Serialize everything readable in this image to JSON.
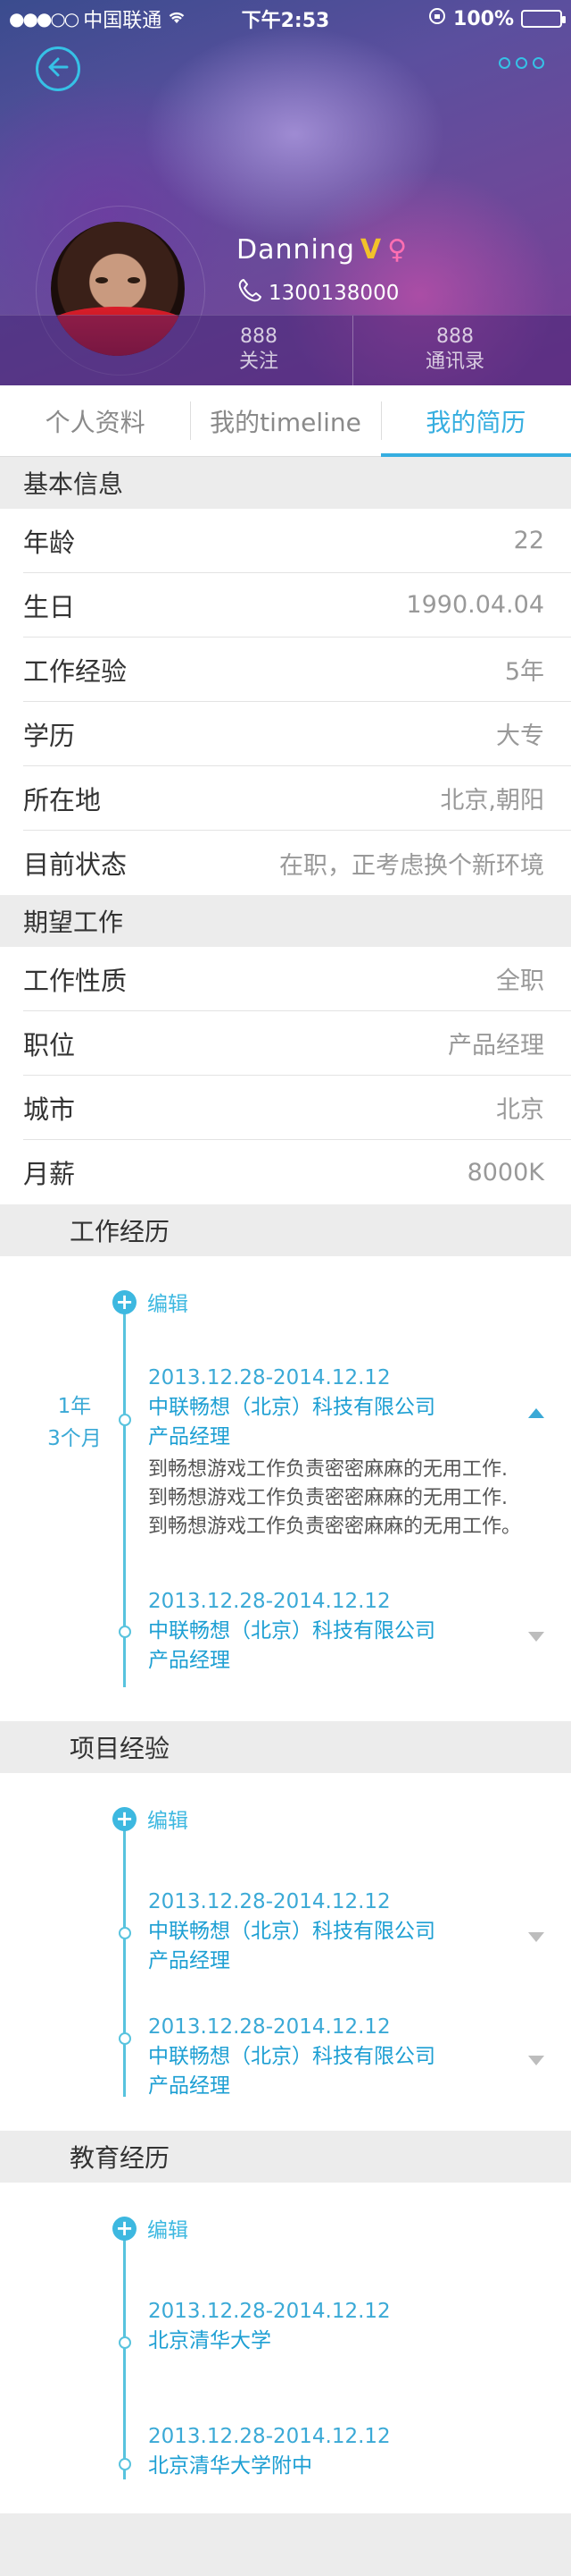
{
  "status_bar": {
    "carrier": "中国联通",
    "time": "下午2:53",
    "battery": "100%"
  },
  "profile": {
    "name": "Danning",
    "vip": "V",
    "gender": "♀",
    "phone": "1300138000",
    "follow_count": "888",
    "follow_label": "关注",
    "contacts_count": "888",
    "contacts_label": "通讯录"
  },
  "tabs": [
    {
      "label": "个人资料"
    },
    {
      "label": "我的timeline"
    },
    {
      "label": "我的简历",
      "active": true
    }
  ],
  "basic_info": {
    "title": "基本信息",
    "rows": [
      {
        "label": "年龄",
        "value": "22"
      },
      {
        "label": "生日",
        "value": "1990.04.04"
      },
      {
        "label": "工作经验",
        "value": "5年"
      },
      {
        "label": "学历",
        "value": "大专"
      },
      {
        "label": "所在地",
        "value": "北京,朝阳"
      },
      {
        "label": "目前状态",
        "value": "在职，正考虑换个新环境"
      }
    ]
  },
  "expected_job": {
    "title": "期望工作",
    "rows": [
      {
        "label": "工作性质",
        "value": "全职"
      },
      {
        "label": "职位",
        "value": "产品经理"
      },
      {
        "label": "城市",
        "value": "北京"
      },
      {
        "label": "月薪",
        "value": "8000K"
      }
    ]
  },
  "work_experience": {
    "title": "工作经历",
    "edit_label": "编辑",
    "duration_years": "1年",
    "duration_months": "3个月",
    "entries": [
      {
        "date": "2013.12.28-2014.12.12",
        "company": "中联畅想（北京）科技有限公司",
        "position": "产品经理",
        "description": "到畅想游戏工作负责密密麻麻的无用工作.到畅想游戏工作负责密密麻麻的无用工作.到畅想游戏工作负责密密麻麻的无用工作。"
      },
      {
        "date": "2013.12.28-2014.12.12",
        "company": "中联畅想（北京）科技有限公司",
        "position": "产品经理"
      }
    ]
  },
  "project_experience": {
    "title": "项目经验",
    "edit_label": "编辑",
    "entries": [
      {
        "date": "2013.12.28-2014.12.12",
        "company": "中联畅想（北京）科技有限公司",
        "position": "产品经理"
      },
      {
        "date": "2013.12.28-2014.12.12",
        "company": "中联畅想（北京）科技有限公司",
        "position": "产品经理"
      }
    ]
  },
  "education": {
    "title": "教育经历",
    "edit_label": "编辑",
    "entries": [
      {
        "date": "2013.12.28-2014.12.12",
        "school": "北京清华大学"
      },
      {
        "date": "2013.12.28-2014.12.12",
        "school": "北京清华大学附中"
      }
    ]
  },
  "colors": {
    "accent": "#36aee0",
    "timeline": "#58c3de",
    "vip": "#f2c22a",
    "gender": "#ff6fb2"
  }
}
